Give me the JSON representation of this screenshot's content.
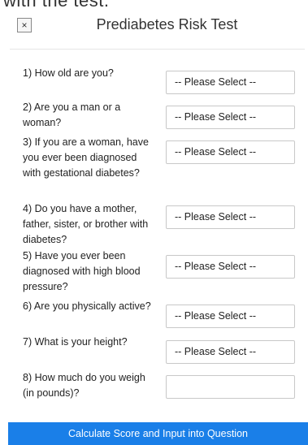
{
  "clipped_text": "with the test.",
  "header": {
    "close_label": "×",
    "title": "Prediabetes Risk Test"
  },
  "questions": [
    {
      "label": "1) How old are you?",
      "value": "-- Please Select --"
    },
    {
      "label": "2) Are you a man or a woman?",
      "value": "-- Please Select --"
    },
    {
      "label": "3) If you are a woman, have you ever been diagnosed with gestational diabetes?",
      "value": "-- Please Select --"
    },
    {
      "label": "4) Do you have a mother, father, sister, or brother with diabetes?",
      "value": "-- Please Select --"
    },
    {
      "label": "5) Have you ever been diagnosed with high blood pressure?",
      "value": "-- Please Select --"
    },
    {
      "label": "6) Are you physically active?",
      "value": "-- Please Select --"
    },
    {
      "label": "7) What is your height?",
      "value": "-- Please Select --"
    },
    {
      "label": "8) How much do you weigh (in pounds)?",
      "value": ""
    }
  ],
  "submit_label": "Calculate Score and Input into Question",
  "colors": {
    "accent": "#1a7fe8"
  }
}
